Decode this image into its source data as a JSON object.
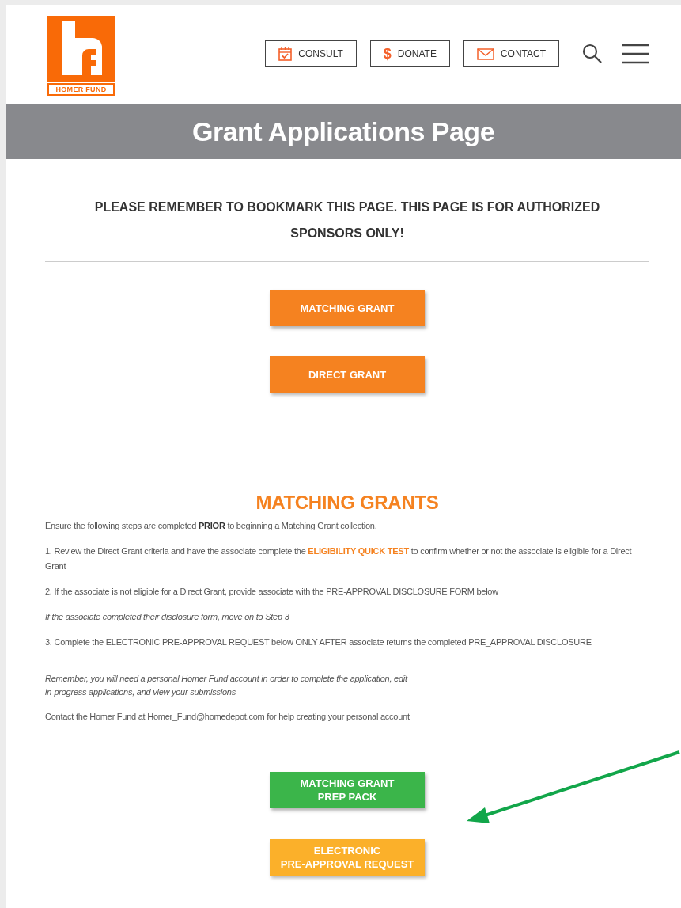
{
  "header": {
    "logo": {
      "wordmark": "HOMER FUND"
    },
    "nav": [
      {
        "kind": "calendar",
        "label": "CONSULT"
      },
      {
        "kind": "text",
        "icon": "$",
        "label": "DONATE"
      },
      {
        "kind": "mail",
        "label": "CONTACT"
      }
    ]
  },
  "banner": {
    "title": "Grant Applications Page"
  },
  "notice": "PLEASE REMEMBER TO BOOKMARK THIS PAGE. THIS PAGE IS FOR AUTHORIZED SPONSORS ONLY!",
  "grant_buttons": [
    {
      "label": "MATCHING GRANT",
      "color": "#f58220"
    },
    {
      "label": "DIRECT GRANT",
      "color": "#f58220"
    }
  ],
  "matching_grants": {
    "heading": "MATCHING GRANTS",
    "paragraphs": [
      {
        "kind": "text",
        "text": "Ensure the following steps are completed **PRIOR** to beginning a Matching Grant collection."
      },
      {
        "kind": "link",
        "before": "1. Review the Direct Grant criteria and have the associate complete the ",
        "link": "ELIGIBILITY QUICK TEST",
        "after": " to confirm whether or not the associate is eligible for a Direct Grant"
      },
      {
        "kind": "text",
        "text": "2. If the associate is not eligible for a Direct Grant, provide associate with the PRE-APPROVAL DISCLOSURE FORM below"
      },
      {
        "kind": "italic",
        "text": "If the associate completed their disclosure form, move on to Step 3"
      },
      {
        "kind": "text",
        "text": "3. Complete the ELECTRONIC PRE-APPROVAL REQUEST below ONLY AFTER associate returns the completed PRE_APPROVAL DISCLOSURE"
      },
      {
        "kind": "italic-lines",
        "lines": [
          "Remember, you will need a personal Homer Fund account in order to complete the application, edit",
          "in-progress applications, and view your submissions"
        ]
      },
      {
        "kind": "text",
        "text": "Contact the Homer Fund at Homer_Fund@homedepot.com for help creating your personal account"
      }
    ],
    "buttons": [
      {
        "lines": [
          "MATCHING GRANT",
          "PREP PACK"
        ],
        "color": "#3bb54a"
      },
      {
        "lines": [
          "ELECTRONIC",
          "PRE-APPROVAL REQUEST"
        ],
        "color": "#fbb02a"
      }
    ]
  }
}
